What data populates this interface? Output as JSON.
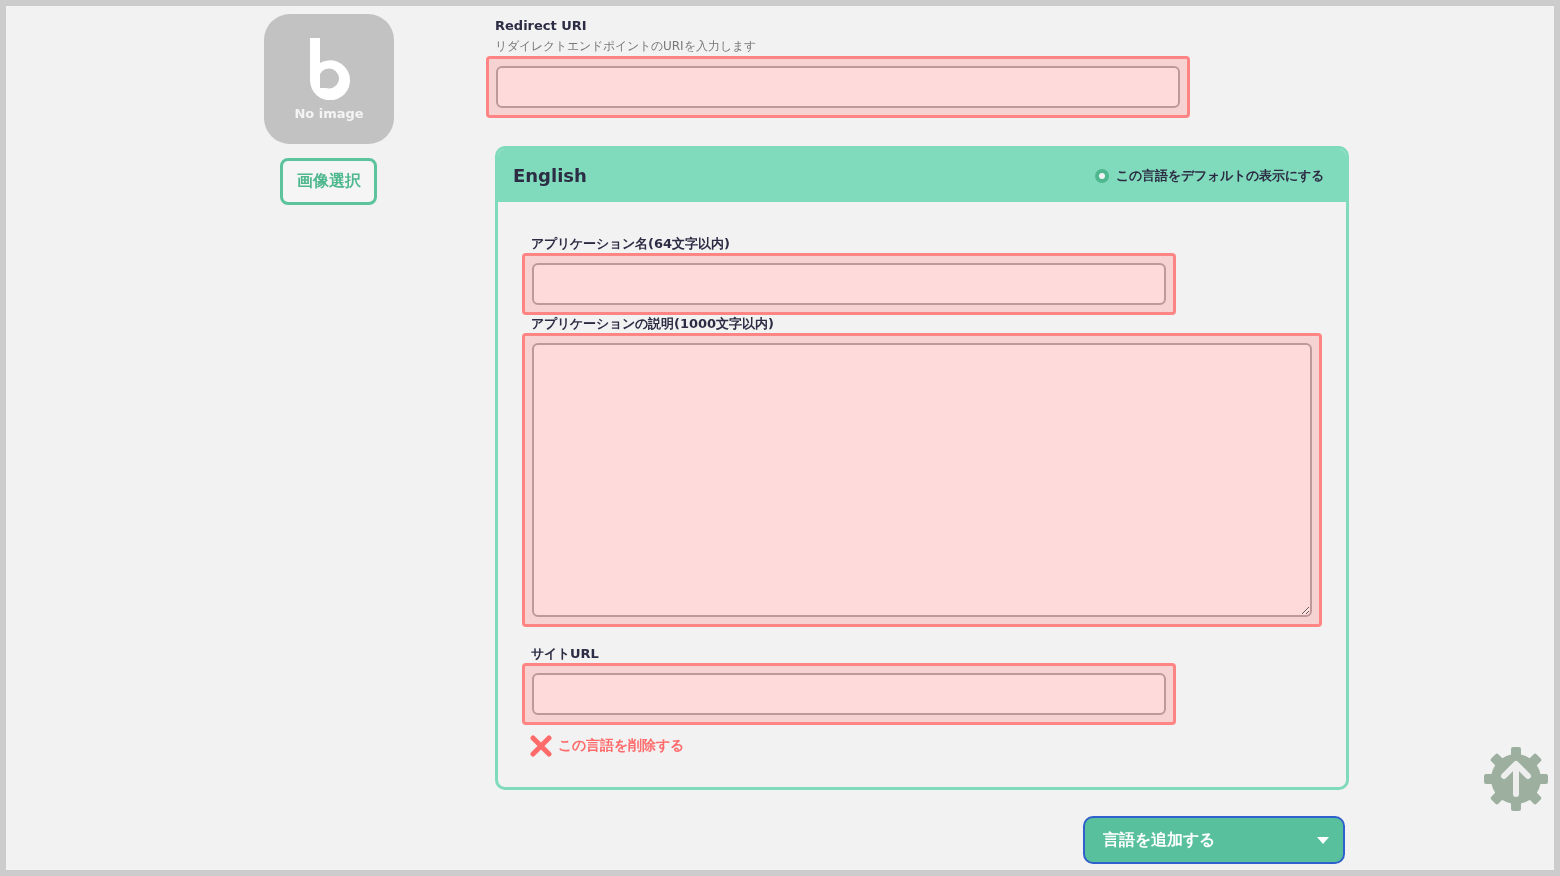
{
  "app_image": {
    "caption": "No image",
    "button": "画像選択"
  },
  "redirect": {
    "label": "Redirect URI",
    "hint": "リダイレクトエンドポイントのURIを入力します",
    "invalid": true
  },
  "language_card": {
    "title": "English",
    "default_radio": {
      "label": "この言語をデフォルトの表示にする",
      "selected": true
    },
    "fields": [
      {
        "kind": "input",
        "label": "アプリケーション名(64文字以内)",
        "invalid": true
      },
      {
        "kind": "textarea",
        "label": "アプリケーションの説明(1000文字以内)",
        "invalid": true
      },
      {
        "kind": "input",
        "label": "サイトURL",
        "invalid": true
      }
    ],
    "delete_link": "この言語を削除する"
  },
  "add_language_button": "言語を追加する"
}
